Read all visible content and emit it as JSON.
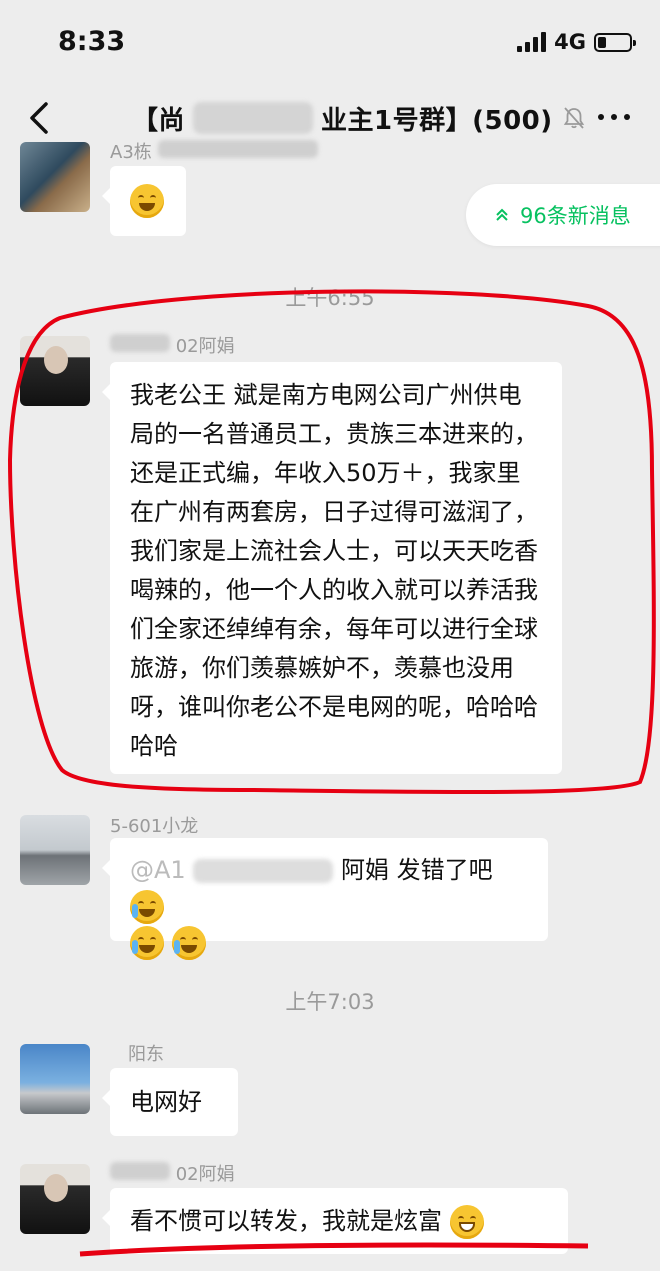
{
  "status_bar": {
    "time": "8:33",
    "network": "4G",
    "battery_level": 0.25
  },
  "nav": {
    "title_left": "【尚",
    "title_right": "业主1号群】(500)",
    "mute_icon": "bell-off-icon",
    "more_icon": "more-dots-icon"
  },
  "new_messages": {
    "label": "96条新消息"
  },
  "messages": [
    {
      "sender": "A3栋",
      "text": ""
    },
    {
      "timestamp": "上午6:55",
      "sender_suffix": "02阿娟",
      "text": "我老公王 斌是南方电网公司广州供电局的一名普通员工，贵族三本进来的，还是正式编，年收入50万＋，我家里在广州有两套房，日子过得可滋润了，我们家是上流社会人士，可以天天吃香喝辣的，他一个人的收入就可以养活我们全家还绰绰有余，每年可以进行全球旅游，你们羡慕嫉妒不，羡慕也没用呀，谁叫你老公不是电网的呢，哈哈哈哈哈"
    },
    {
      "sender": "5-601小龙",
      "text_prefix": "@A1",
      "text": "阿娟 发错了吧"
    },
    {
      "timestamp": "上午7:03",
      "sender": "阳东",
      "text": "电网好"
    },
    {
      "sender_suffix": "02阿娟",
      "text": "看不惯可以转发，我就是炫富"
    }
  ],
  "colors": {
    "background": "#ededed",
    "bubble": "#ffffff",
    "accent_green": "#07c160",
    "annotation_red": "#e60012"
  }
}
